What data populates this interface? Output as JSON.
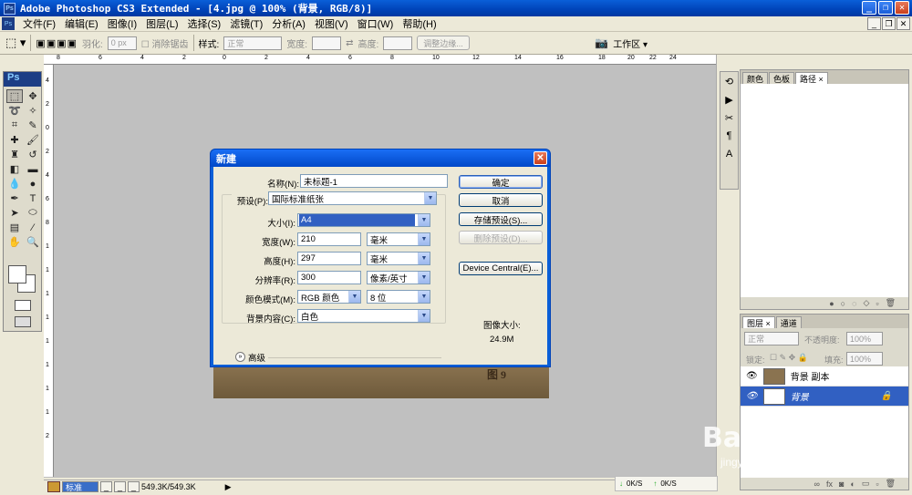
{
  "window": {
    "title": "Adobe Photoshop CS3 Extended - [4.jpg @ 100% (背景, RGB/8)]",
    "app_icon": "Ps"
  },
  "menu": [
    "文件(F)",
    "编辑(E)",
    "图像(I)",
    "图层(L)",
    "选择(S)",
    "滤镜(T)",
    "分析(A)",
    "视图(V)",
    "窗口(W)",
    "帮助(H)"
  ],
  "options": {
    "feather_label": "羽化:",
    "feather_value": "0 px",
    "antialias_label": "消除锯齿",
    "style_label": "样式:",
    "style_value": "正常",
    "width_label": "宽度:",
    "height_label": "高度:",
    "refine_button": "调整边缘...",
    "workspace_label": "工作区 ▾"
  },
  "toolbox": {
    "logo": "Ps"
  },
  "ruler_h": [
    "8",
    "6",
    "4",
    "2",
    "0",
    "2",
    "4",
    "6",
    "8",
    "10",
    "12",
    "14",
    "16",
    "18",
    "20",
    "22",
    "24"
  ],
  "ruler_v": [
    "4",
    "2",
    "0",
    "2",
    "4",
    "6",
    "8",
    "1",
    "1",
    "1",
    "1",
    "1",
    "1",
    "1",
    "1",
    "2"
  ],
  "canvas": {
    "caption": "图 9"
  },
  "status": {
    "zoom": "标准",
    "doc_size": "549.3K/549.3K"
  },
  "tray": {
    "down": "0K/S",
    "up": "0K/S"
  },
  "panel_top": {
    "tabs": [
      "颜色",
      "色板",
      "路径 ×"
    ]
  },
  "panel_layers": {
    "tabs": [
      "图层 ×",
      "通道"
    ],
    "blend_mode": "正常",
    "opacity_label": "不透明度:",
    "opacity_value": "100%",
    "lock_label": "锁定:",
    "fill_label": "填充:",
    "fill_value": "100%",
    "layers": [
      {
        "name": "背景 副本",
        "selected": false
      },
      {
        "name": "背景",
        "selected": true
      }
    ]
  },
  "dialog": {
    "title": "新建",
    "name_label": "名称(N):",
    "name_value": "未标题-1",
    "preset_label": "预设(P):",
    "preset_value": "国际标准纸张",
    "size_label": "大小(I):",
    "size_value": "A4",
    "width_label": "宽度(W):",
    "width_value": "210",
    "width_unit": "毫米",
    "height_label": "高度(H):",
    "height_value": "297",
    "height_unit": "毫米",
    "resolution_label": "分辨率(R):",
    "resolution_value": "300",
    "resolution_unit": "像素/英寸",
    "mode_label": "颜色模式(M):",
    "mode_value": "RGB 颜色",
    "bit_value": "8 位",
    "bg_label": "背景内容(C):",
    "bg_value": "白色",
    "advanced_label": "高级",
    "ok_button": "确定",
    "cancel_button": "取消",
    "save_preset_button": "存储预设(S)...",
    "delete_preset_button": "删除预设(D)...",
    "device_central_button": "Device Central(E)...",
    "image_size_label": "图像大小:",
    "image_size_value": "24.9M"
  },
  "watermark": {
    "brand": "Baidu经验",
    "url": "jingyan.baidu.com"
  },
  "colors": {
    "title_blue": "#0a5fd8",
    "selection_blue": "#3160c2",
    "workspace_gray": "#c0c0c0"
  }
}
